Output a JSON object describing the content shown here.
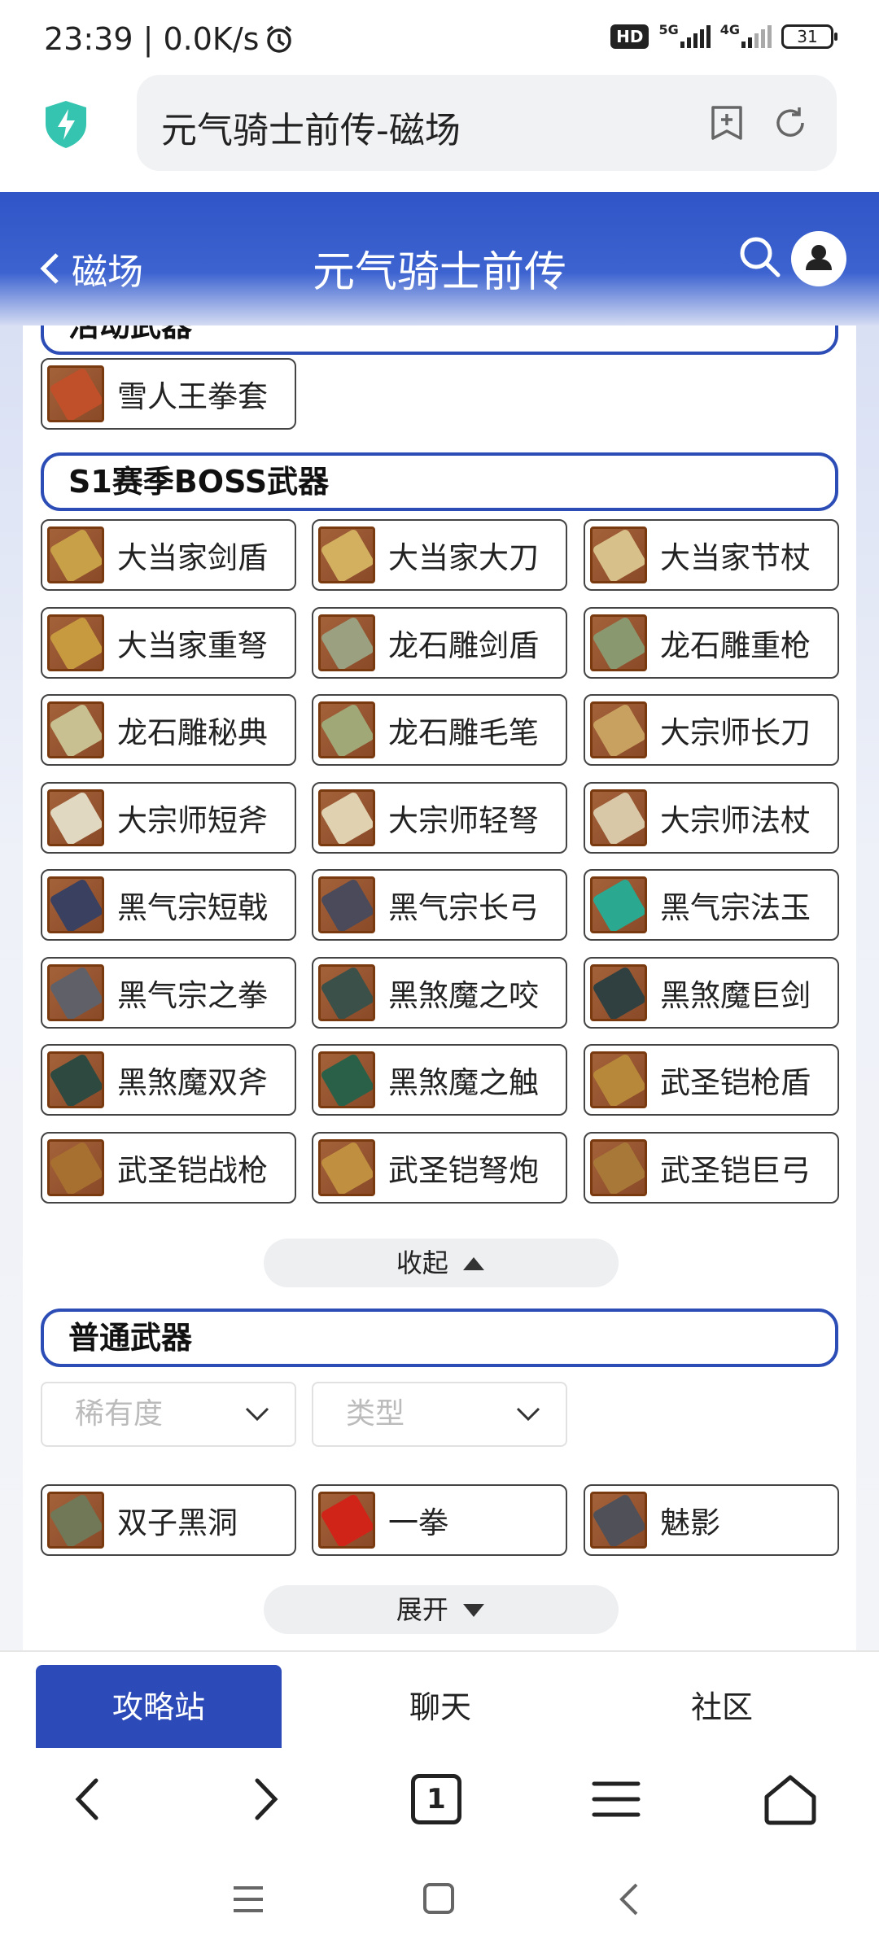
{
  "status_bar": {
    "time_speed": "23:39 | 0.0K/s",
    "hd_badge": "HD",
    "net1": "5G",
    "net2": "4G",
    "battery": "31"
  },
  "browser": {
    "url_title": "元气骑士前传-磁场"
  },
  "app_header": {
    "back_label": "磁场",
    "title": "元气骑士前传"
  },
  "sections": {
    "partial_title": "活动武器",
    "boss_title": "S1赛季BOSS武器",
    "normal_title": "普通武器"
  },
  "activity_weapons": [
    {
      "label": "雪人王拳套",
      "icon": "glove-icon",
      "color": "#c0502a"
    }
  ],
  "boss_weapons": [
    {
      "label": "大当家剑盾",
      "icon": "sword-shield-icon",
      "color": "#c8a048"
    },
    {
      "label": "大当家大刀",
      "icon": "broad-blade-icon",
      "color": "#d2b060"
    },
    {
      "label": "大当家节杖",
      "icon": "scepter-icon",
      "color": "#d8c08a"
    },
    {
      "label": "大当家重弩",
      "icon": "heavy-crossbow-icon",
      "color": "#c89a40"
    },
    {
      "label": "龙石雕剑盾",
      "icon": "dragon-sword-shield-icon",
      "color": "#9aa080"
    },
    {
      "label": "龙石雕重枪",
      "icon": "dragon-spear-icon",
      "color": "#8a9870"
    },
    {
      "label": "龙石雕秘典",
      "icon": "tome-icon",
      "color": "#c8c090"
    },
    {
      "label": "龙石雕毛笔",
      "icon": "brush-icon",
      "color": "#a0a878"
    },
    {
      "label": "大宗师长刀",
      "icon": "long-blade-icon",
      "color": "#c8a060"
    },
    {
      "label": "大宗师短斧",
      "icon": "short-axe-icon",
      "color": "#e0d8c0"
    },
    {
      "label": "大宗师轻弩",
      "icon": "light-crossbow-icon",
      "color": "#e0d2b0"
    },
    {
      "label": "大宗师法杖",
      "icon": "staff-icon",
      "color": "#d8c8a8"
    },
    {
      "label": "黑气宗短戟",
      "icon": "halberd-icon",
      "color": "#3a4060"
    },
    {
      "label": "黑气宗长弓",
      "icon": "longbow-icon",
      "color": "#4a4a5a"
    },
    {
      "label": "黑气宗法玉",
      "icon": "jade-orb-icon",
      "color": "#2aa890"
    },
    {
      "label": "黑气宗之拳",
      "icon": "fist-icon",
      "color": "#606068"
    },
    {
      "label": "黑煞魔之咬",
      "icon": "bite-icon",
      "color": "#3a5048"
    },
    {
      "label": "黑煞魔巨剑",
      "icon": "greatsword-icon",
      "color": "#304040"
    },
    {
      "label": "黑煞魔双斧",
      "icon": "dual-axe-icon",
      "color": "#2e4a40"
    },
    {
      "label": "黑煞魔之触",
      "icon": "tentacle-icon",
      "color": "#2a6048"
    },
    {
      "label": "武圣铠枪盾",
      "icon": "spear-shield-icon",
      "color": "#b8883a"
    },
    {
      "label": "武圣铠战枪",
      "icon": "war-spear-icon",
      "color": "#a87030"
    },
    {
      "label": "武圣铠弩炮",
      "icon": "ballista-icon",
      "color": "#c09040"
    },
    {
      "label": "武圣铠巨弓",
      "icon": "great-bow-icon",
      "color": "#a87838"
    }
  ],
  "collapse_label": "收起",
  "filters": {
    "rarity": "稀有度",
    "type": "类型"
  },
  "normal_weapons": [
    {
      "label": "双子黑洞",
      "icon": "black-hole-icon",
      "color": "#707858"
    },
    {
      "label": "一拳",
      "icon": "red-fist-icon",
      "color": "#d02418"
    },
    {
      "label": "魅影",
      "icon": "phantom-blade-icon",
      "color": "#505058"
    }
  ],
  "expand_label": "展开",
  "bottom_tabs": [
    "攻略站",
    "聊天",
    "社区"
  ],
  "nav": {
    "tab_count": "1"
  }
}
